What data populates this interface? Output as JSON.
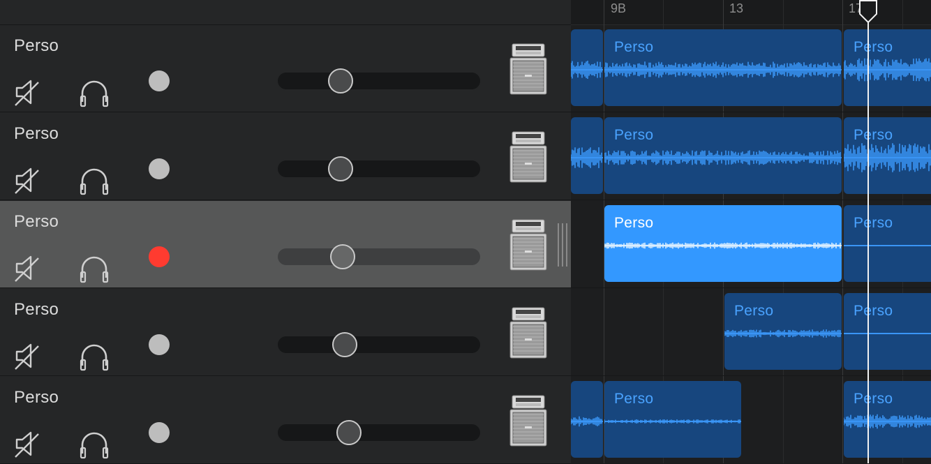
{
  "ruler": {
    "labels": [
      "9B",
      "13",
      "17C"
    ]
  },
  "tracks": [
    {
      "name": "Perso",
      "record_armed": false,
      "volume": 0.31,
      "selected": false
    },
    {
      "name": "Perso",
      "record_armed": false,
      "volume": 0.31,
      "selected": false
    },
    {
      "name": "Perso",
      "record_armed": true,
      "volume": 0.32,
      "selected": true
    },
    {
      "name": "Perso",
      "record_armed": false,
      "volume": 0.33,
      "selected": false
    },
    {
      "name": "Perso",
      "record_armed": false,
      "volume": 0.35,
      "selected": false
    }
  ],
  "regions": [
    {
      "lane": 0,
      "label": "",
      "selected": false
    },
    {
      "lane": 0,
      "label": "Perso",
      "selected": false
    },
    {
      "lane": 0,
      "label": "Perso",
      "selected": false
    },
    {
      "lane": 1,
      "label": "",
      "selected": false
    },
    {
      "lane": 1,
      "label": "Perso",
      "selected": false
    },
    {
      "lane": 1,
      "label": "Perso",
      "selected": false
    },
    {
      "lane": 2,
      "label": "Perso",
      "selected": true
    },
    {
      "lane": 2,
      "label": "Perso",
      "selected": false
    },
    {
      "lane": 3,
      "label": "Perso",
      "selected": false
    },
    {
      "lane": 3,
      "label": "Perso",
      "selected": false
    },
    {
      "lane": 4,
      "label": "",
      "selected": false
    },
    {
      "lane": 4,
      "label": "Perso",
      "selected": false
    },
    {
      "lane": 4,
      "label": "Perso",
      "selected": false
    }
  ],
  "colors": {
    "region": "#17467e",
    "region_selected": "#3398ff",
    "region_label": "#4aa3ff",
    "waveform": "#3a95f5",
    "record_armed": "#ff3b30",
    "record_idle": "#bdbdbd"
  },
  "icons": [
    "mute-speaker-icon",
    "headphones-icon",
    "record-icon",
    "guitar-amp-icon",
    "playhead-icon",
    "drag-handle-icon"
  ]
}
